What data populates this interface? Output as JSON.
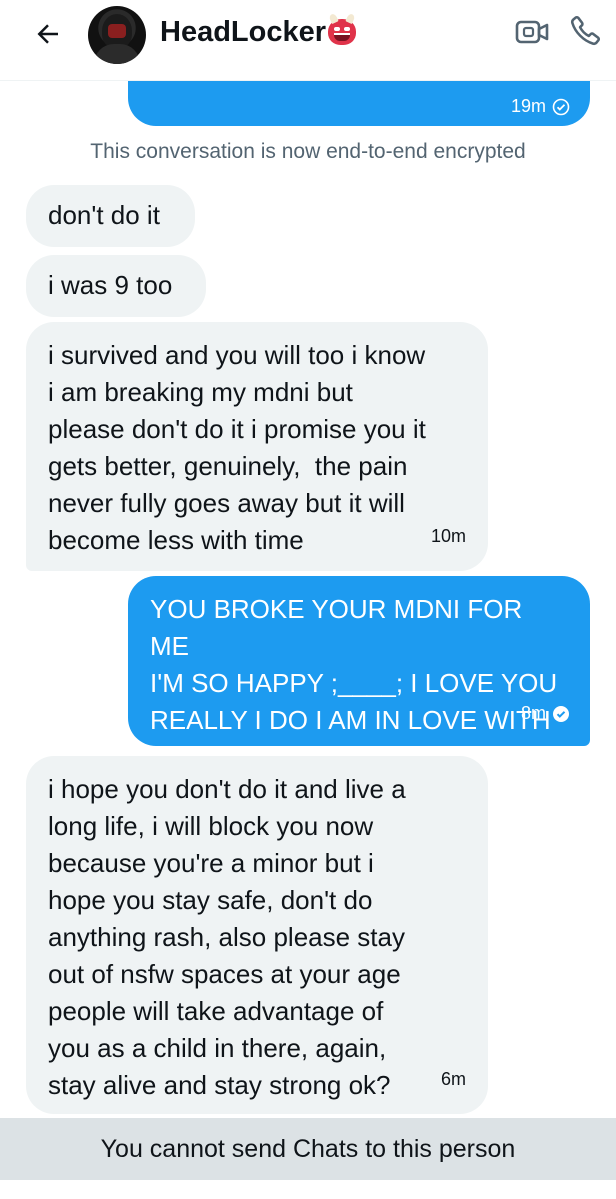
{
  "header": {
    "name": "HeadLocker",
    "icons": {
      "back": "arrow-left-icon",
      "video": "video-call-icon",
      "call": "phone-icon",
      "emoji": "ogre-emoji-icon"
    }
  },
  "conversation": {
    "encryption_note": "This conversation is now end-to-end encrypted",
    "messages": [
      {
        "direction": "out",
        "text": "",
        "time": "19m"
      },
      {
        "direction": "in",
        "text": "don't do it",
        "time": ""
      },
      {
        "direction": "in",
        "text": "i was 9 too",
        "time": ""
      },
      {
        "direction": "in",
        "text": "i survived and you will too i know\ni am breaking my mdni but\nplease don't do it i promise you it\ngets better, genuinely,  the pain\nnever fully goes away but it will\nbecome less with time",
        "time": "10m"
      },
      {
        "direction": "out",
        "text": "YOU BROKE YOUR MDNI FOR ME\nI'M SO HAPPY ;____; I LOVE YOU\nREALLY I DO I AM IN LOVE WITH\nYOU",
        "time": "8m"
      },
      {
        "direction": "in",
        "text": "i hope you don't do it and live a\nlong life, i will block you now\nbecause you're a minor but i\nhope you stay safe, don't do\nanything rash, also please stay\nout of nsfw spaces at your age\npeople will take advantage of\nyou as a child in there, again,\nstay alive and stay strong ok?",
        "time": "6m"
      }
    ]
  },
  "footer": {
    "notice": "You cannot send Chats to this person"
  },
  "colors": {
    "accent": "#1d9bf0",
    "incoming_bg": "#eff3f4",
    "footer_bg": "#dce2e5",
    "muted": "#536471"
  }
}
